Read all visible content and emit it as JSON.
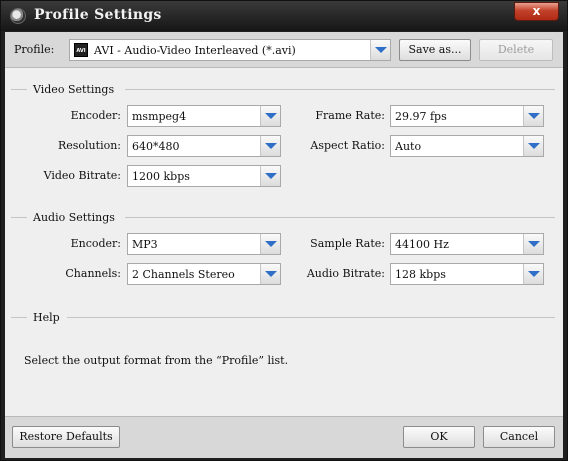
{
  "window": {
    "title": "Profile Settings",
    "close_glyph": "x"
  },
  "profile": {
    "label": "Profile:",
    "selected": "AVI - Audio-Video Interleaved (*.avi)",
    "format_icon_text": "AVI",
    "save_as_label": "Save as...",
    "delete_label": "Delete"
  },
  "video": {
    "title": "Video Settings",
    "encoder_label": "Encoder:",
    "encoder_value": "msmpeg4",
    "frame_rate_label": "Frame Rate:",
    "frame_rate_value": "29.97 fps",
    "resolution_label": "Resolution:",
    "resolution_value": "640*480",
    "aspect_ratio_label": "Aspect Ratio:",
    "aspect_ratio_value": "Auto",
    "bitrate_label": "Video Bitrate:",
    "bitrate_value": "1200 kbps"
  },
  "audio": {
    "title": "Audio Settings",
    "encoder_label": "Encoder:",
    "encoder_value": "MP3",
    "sample_rate_label": "Sample Rate:",
    "sample_rate_value": "44100 Hz",
    "channels_label": "Channels:",
    "channels_value": "2 Channels Stereo",
    "bitrate_label": "Audio Bitrate:",
    "bitrate_value": "128 kbps"
  },
  "help": {
    "title": "Help",
    "text": "Select the output format from the “Profile” list."
  },
  "footer": {
    "restore_label": "Restore Defaults",
    "ok_label": "OK",
    "cancel_label": "Cancel"
  },
  "colors": {
    "title_bar": "#1f1f1f",
    "close_button": "#c2412a",
    "dropdown_arrow": "#2f6fc8",
    "panel": "#efefef"
  }
}
